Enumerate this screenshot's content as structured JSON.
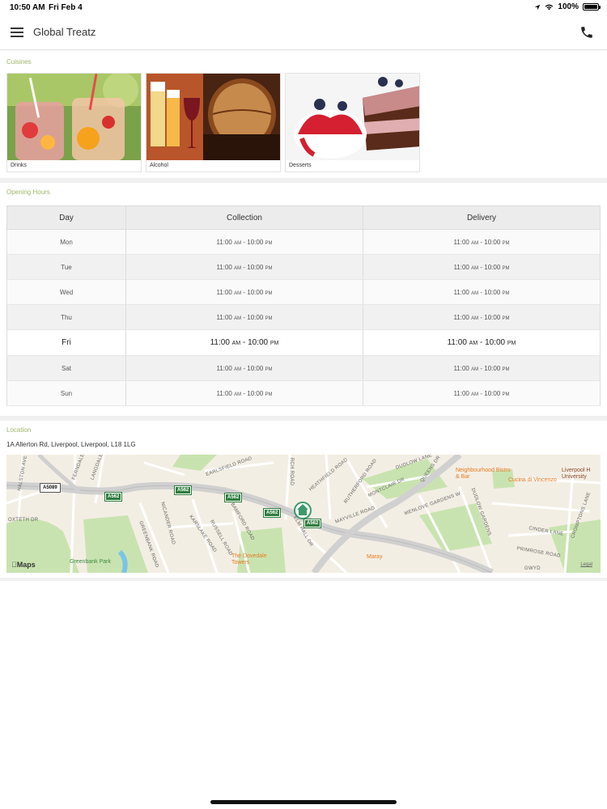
{
  "status_bar": {
    "time": "10:50 AM",
    "date": "Fri Feb 4",
    "battery": "100%"
  },
  "header": {
    "title": "Global Treatz",
    "menu_icon": "hamburger-menu-icon",
    "phone_icon": "phone-icon"
  },
  "cuisines": {
    "heading": "Cuisines",
    "items": [
      {
        "label": "Drinks"
      },
      {
        "label": "Alcohol"
      },
      {
        "label": "Desserts"
      }
    ]
  },
  "opening_hours": {
    "heading": "Opening Hours",
    "columns": [
      "Day",
      "Collection",
      "Delivery"
    ],
    "rows": [
      {
        "day": "Mon",
        "collection": {
          "open": "11:00",
          "open_ampm": "AM",
          "sep": "-",
          "close": "10:00",
          "close_ampm": "PM"
        },
        "delivery": {
          "open": "11:00",
          "open_ampm": "AM",
          "sep": "-",
          "close": "10:00",
          "close_ampm": "PM"
        }
      },
      {
        "day": "Tue",
        "collection": {
          "open": "11:00",
          "open_ampm": "AM",
          "sep": "-",
          "close": "10:00",
          "close_ampm": "PM"
        },
        "delivery": {
          "open": "11:00",
          "open_ampm": "AM",
          "sep": "-",
          "close": "10:00",
          "close_ampm": "PM"
        }
      },
      {
        "day": "Wed",
        "collection": {
          "open": "11:00",
          "open_ampm": "AM",
          "sep": "-",
          "close": "10:00",
          "close_ampm": "PM"
        },
        "delivery": {
          "open": "11:00",
          "open_ampm": "AM",
          "sep": "-",
          "close": "10:00",
          "close_ampm": "PM"
        }
      },
      {
        "day": "Thu",
        "collection": {
          "open": "11:00",
          "open_ampm": "AM",
          "sep": "-",
          "close": "10:00",
          "close_ampm": "PM"
        },
        "delivery": {
          "open": "11:00",
          "open_ampm": "AM",
          "sep": "-",
          "close": "10:00",
          "close_ampm": "PM"
        }
      },
      {
        "day": "Fri",
        "collection": {
          "open": "11:00",
          "open_ampm": "AM",
          "sep": "-",
          "close": "10:00",
          "close_ampm": "PM"
        },
        "delivery": {
          "open": "11:00",
          "open_ampm": "AM",
          "sep": "-",
          "close": "10:00",
          "close_ampm": "PM"
        }
      },
      {
        "day": "Sat",
        "collection": {
          "open": "11:00",
          "open_ampm": "AM",
          "sep": "-",
          "close": "10:00",
          "close_ampm": "PM"
        },
        "delivery": {
          "open": "11:00",
          "open_ampm": "AM",
          "sep": "-",
          "close": "10:00",
          "close_ampm": "PM"
        }
      },
      {
        "day": "Sun",
        "collection": {
          "open": "11:00",
          "open_ampm": "AM",
          "sep": "-",
          "close": "10:00",
          "close_ampm": "PM"
        },
        "delivery": {
          "open": "11:00",
          "open_ampm": "AM",
          "sep": "-",
          "close": "10:00",
          "close_ampm": "PM"
        }
      }
    ],
    "highlighted_day": "Fri"
  },
  "location": {
    "heading": "Location",
    "address": "1A Allerton Rd, Liverpool, Liverpool, L18 1LG",
    "map": {
      "road_labels": [
        "HALSTON AVE",
        "FERNDALE",
        "LANGDALE",
        "GREENBANK ROAD",
        "NICANDER ROAD",
        "EARLSFIELD ROAD",
        "BAMFORD ROAD",
        "KARSLAKE ROAD",
        "RUSSELL ROAD",
        "RCH ROAD",
        "HEATHFIELD ROAD",
        "RUTHERFORD ROAD",
        "MONTCLAIR DR",
        "DUDLOW LANE",
        "QUEENS DR",
        "MAYVILLE ROAD",
        "MENLOVE GARDENS W",
        "ELM HALL DR",
        "CINDER LANE",
        "CROMPTONS LANE",
        "PRIMROSE ROAD",
        "GWYD",
        "DUDLOW GARDENS",
        "OXTETH DR"
      ],
      "shields": [
        "A5089",
        "A562",
        "A562",
        "A562",
        "A562",
        "A562"
      ],
      "pois": [
        "Neighbourhood Bistro & Bar",
        "Cucina di Vincenzo",
        "Liverpool H University",
        "The Dovedale Towers",
        "Maray",
        "Greenbank Park"
      ],
      "logo": "Maps",
      "legal": "Legal"
    }
  },
  "colors": {
    "accent": "#9fb56a",
    "map_green": "#c9e3b0",
    "road_shield": "#2f7d3f",
    "poi": "#e57b1f",
    "pin": "#3d9a6a"
  }
}
